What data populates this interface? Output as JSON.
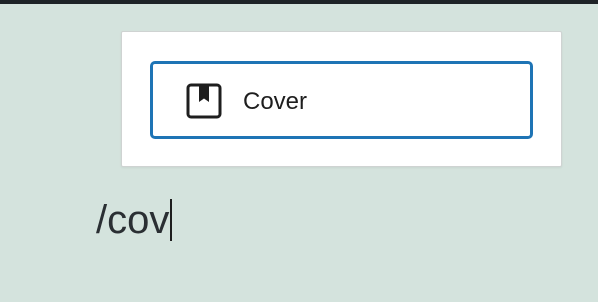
{
  "window": {
    "topbar_color": "#1e2327"
  },
  "autocomplete": {
    "items": [
      {
        "label": "Cover",
        "icon": "cover-block-icon",
        "selected": true
      }
    ]
  },
  "editor": {
    "text": "/cov"
  },
  "colors": {
    "background": "#d4e3dd",
    "accent": "#1e74b5",
    "popover_bg": "#ffffff",
    "text": "#1e1e1e"
  }
}
